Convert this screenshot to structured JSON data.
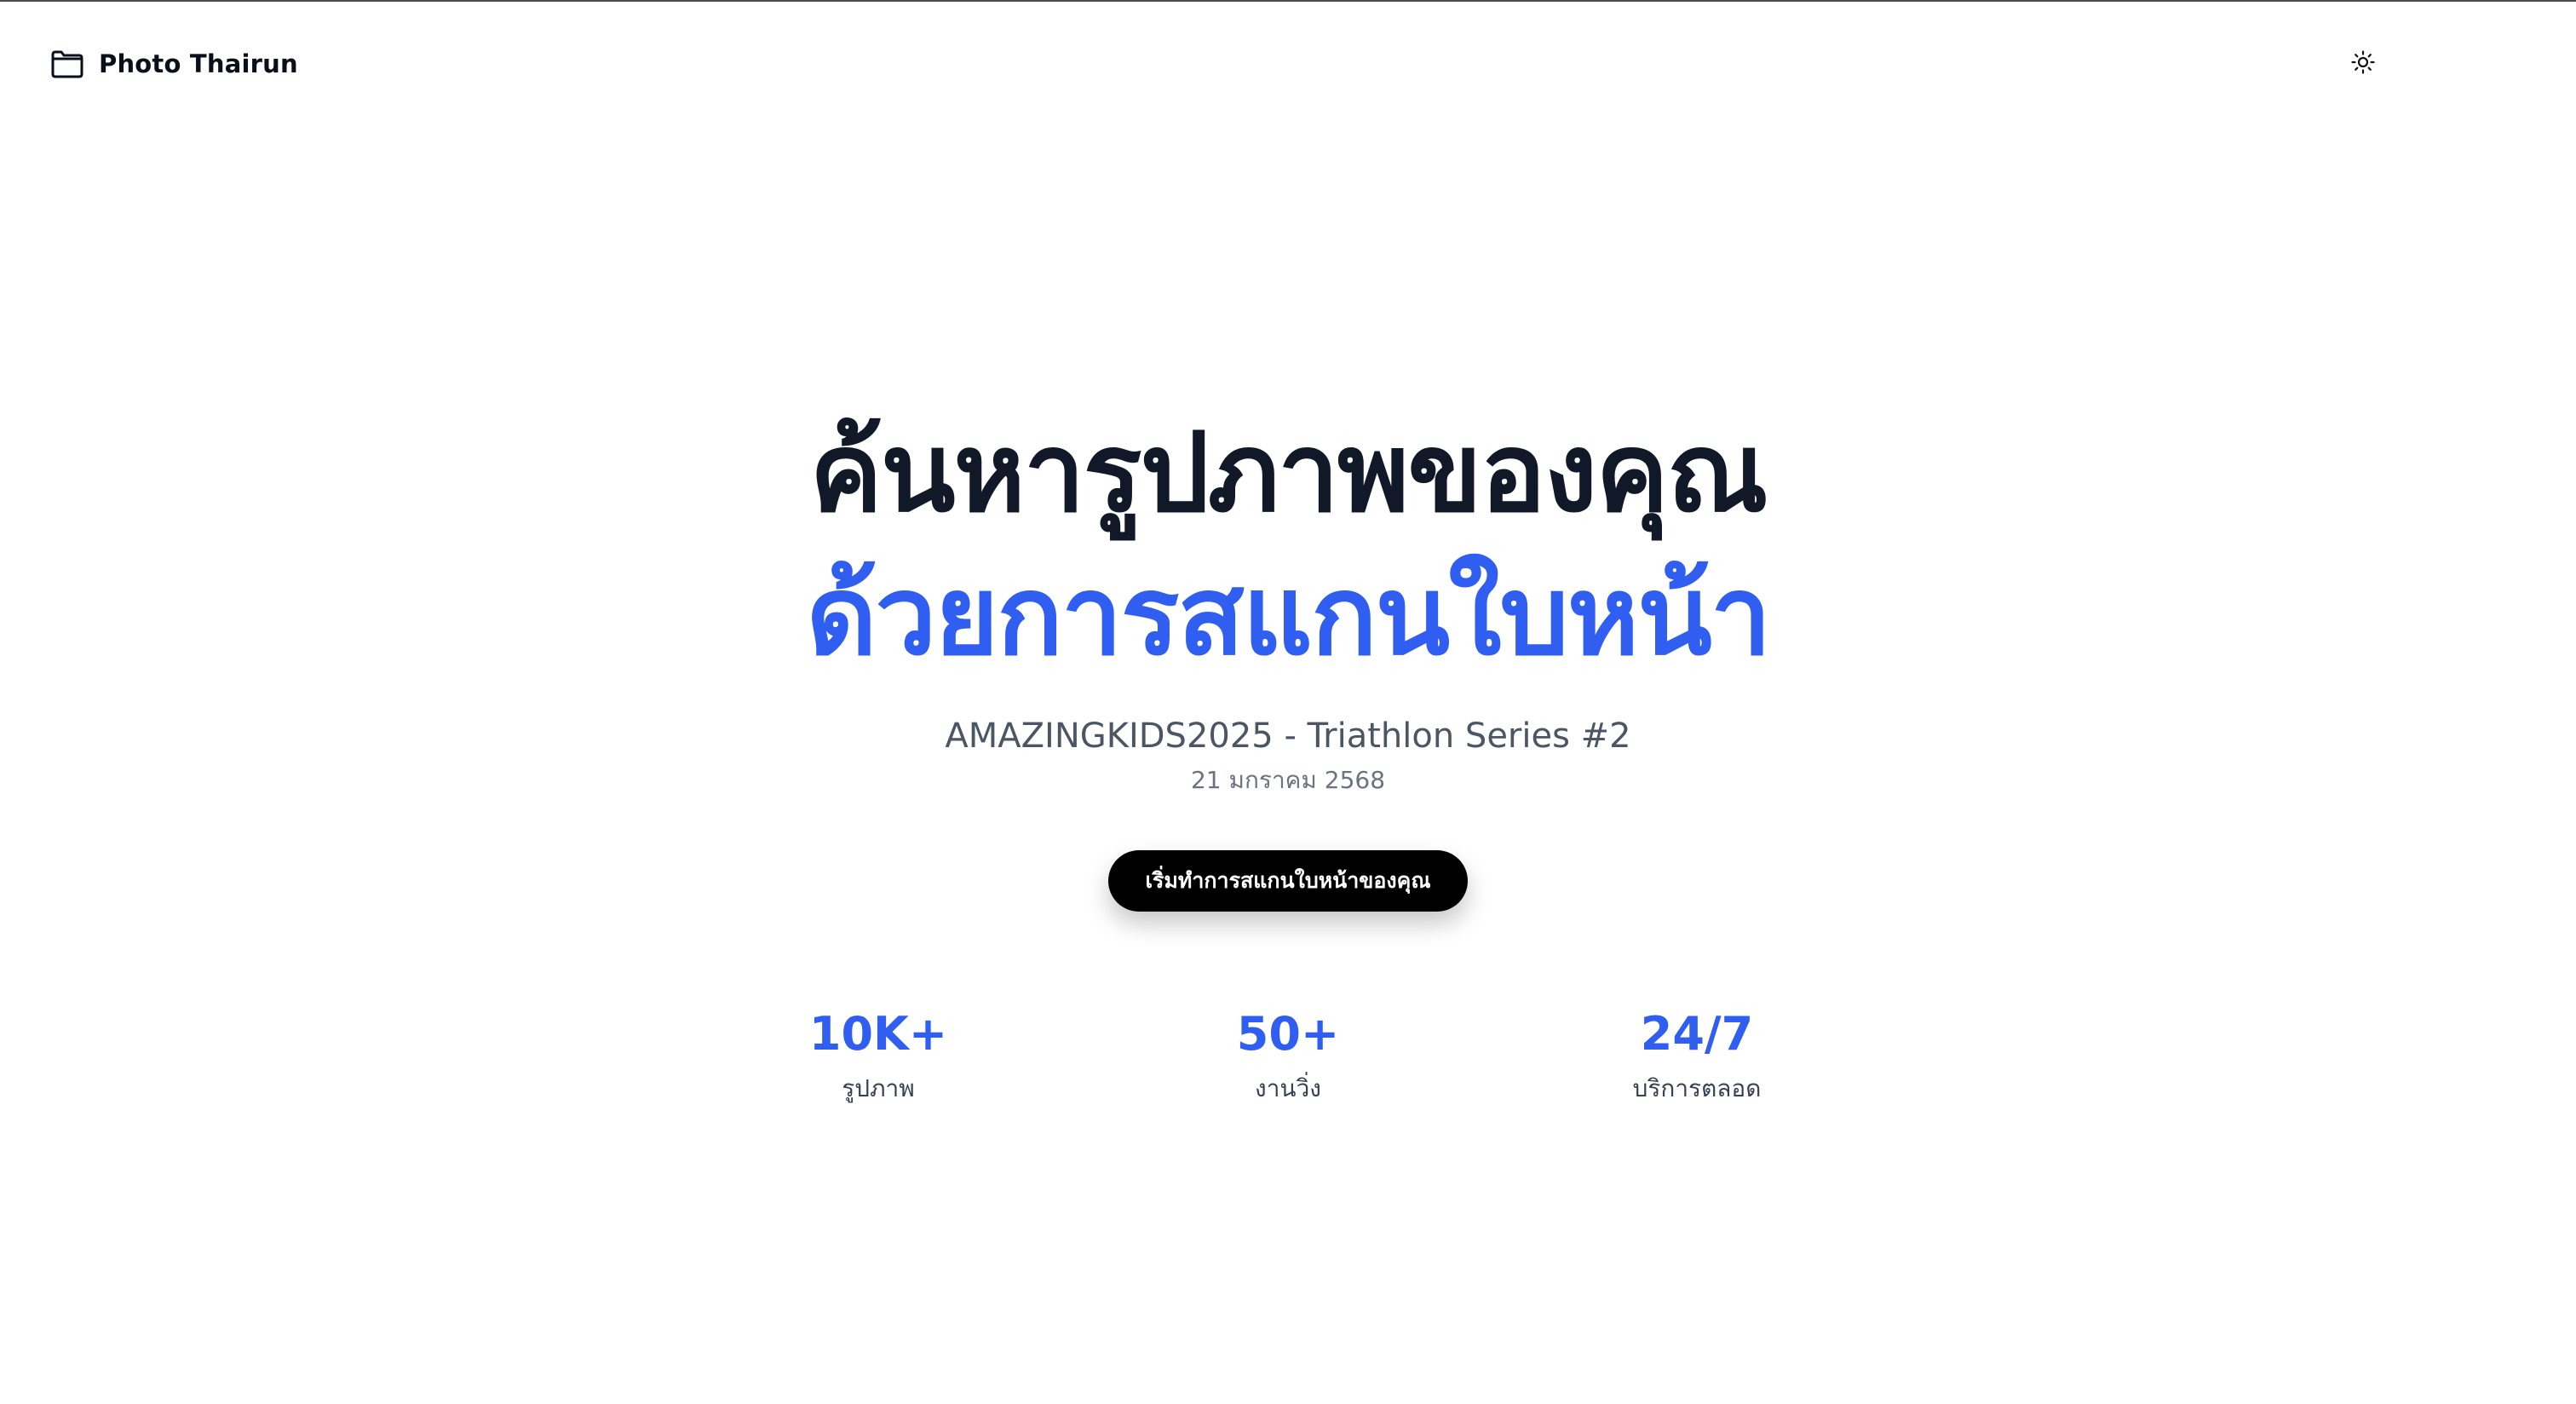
{
  "header": {
    "brand_name": "Photo Thairun",
    "brand_icon": "folder-icon",
    "theme_toggle_icon": "sun-icon"
  },
  "hero": {
    "title_line1": "ค้นหารูปภาพของคุณ",
    "title_line2": "ด้วยการสแกนใบหน้า",
    "event_name": "AMAZINGKIDS2025 - Triathlon Series #2",
    "event_date": "21 มกราคม 2568",
    "cta_label": "เริ่มทำการสแกนใบหน้าของคุณ"
  },
  "stats": [
    {
      "value": "10K+",
      "label": "รูปภาพ"
    },
    {
      "value": "50+",
      "label": "งานวิ่ง"
    },
    {
      "value": "24/7",
      "label": "บริการตลอด"
    }
  ],
  "colors": {
    "accent": "#2f5ef0",
    "title": "#111827",
    "cta_background": "#000000",
    "cta_text": "#ffffff",
    "muted_text": "#4b5563"
  }
}
